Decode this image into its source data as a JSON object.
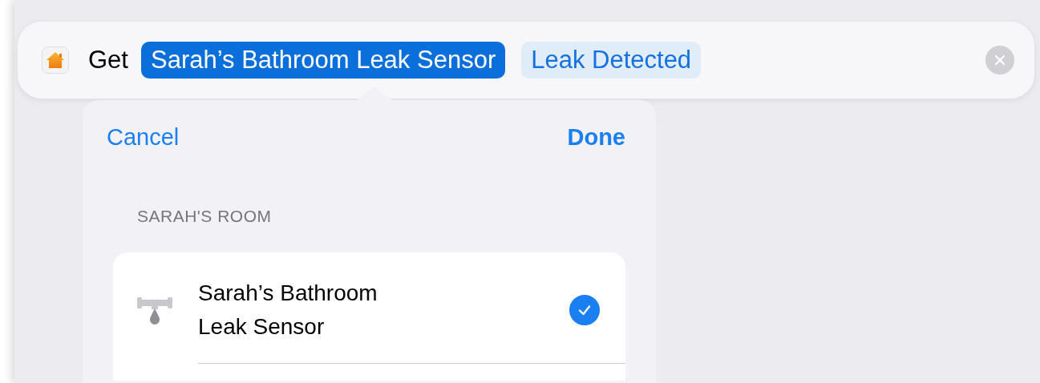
{
  "action_bar": {
    "label": "Get",
    "tokens": [
      {
        "text": "Sarah’s Bathroom Leak Sensor",
        "selected": true
      },
      {
        "text": "Leak Detected",
        "selected": false
      }
    ]
  },
  "picker": {
    "cancel": "Cancel",
    "done": "Done",
    "section_header": "SARAH'S ROOM",
    "items": [
      {
        "name": "Sarah’s Bathroom\nLeak Sensor",
        "checked": true
      }
    ]
  }
}
